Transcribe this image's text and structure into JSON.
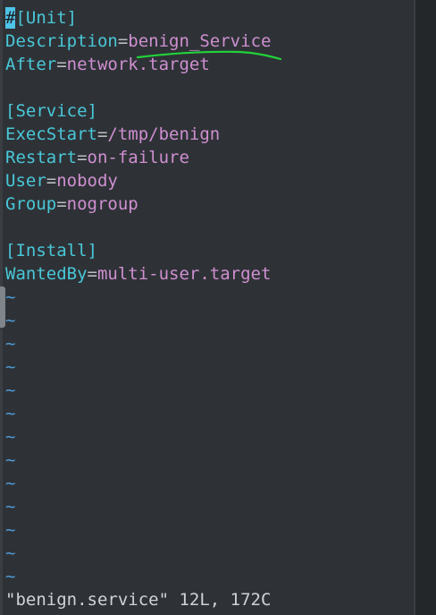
{
  "editor": {
    "lines": [
      {
        "type": "section",
        "cursor": "#",
        "text": "[Unit]"
      },
      {
        "type": "kv",
        "key": "Description",
        "value": "benign_Service"
      },
      {
        "type": "kv",
        "key": "After",
        "value": "network.target"
      },
      {
        "type": "blank"
      },
      {
        "type": "section",
        "text": "[Service]"
      },
      {
        "type": "kv",
        "key": "ExecStart",
        "value": "/tmp/benign"
      },
      {
        "type": "kv",
        "key": "Restart",
        "value": "on-failure"
      },
      {
        "type": "kv",
        "key": "User",
        "value": "nobody"
      },
      {
        "type": "kv",
        "key": "Group",
        "value": "nogroup"
      },
      {
        "type": "blank"
      },
      {
        "type": "section",
        "text": "[Install]"
      },
      {
        "type": "kv",
        "key": "WantedBy",
        "value": "multi-user.target"
      }
    ],
    "tilde_char": "~",
    "tilde_count": 13,
    "status": "\"benign.service\" 12L, 172C"
  },
  "annotation": {
    "underline_color": "#22d13a",
    "underlined_value": "benign_Service"
  },
  "colors": {
    "background": "#2e3236",
    "section": "#49c7d8",
    "value": "#cf8fd1",
    "tilde": "#4f9bd8",
    "cursor": "#4fc3e8"
  }
}
